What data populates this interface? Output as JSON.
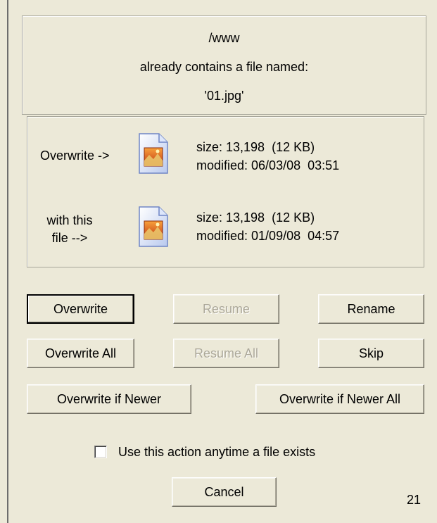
{
  "message": {
    "path": "/www",
    "text": "already contains a file named:",
    "filename": "'01.jpg'"
  },
  "compare": {
    "existing_label": "Overwrite ->",
    "existing_size": "size: 13,198  (12 KB)",
    "existing_modified": "modified: 06/03/08  03:51",
    "new_label_line1": "with this",
    "new_label_line2": "file -->",
    "new_size": "size: 13,198  (12 KB)",
    "new_modified": "modified: 01/09/08  04:57",
    "icon": "image-file-icon"
  },
  "buttons": {
    "overwrite": "Overwrite",
    "resume": "Resume",
    "rename": "Rename",
    "overwrite_all": "Overwrite All",
    "resume_all": "Resume All",
    "skip": "Skip",
    "overwrite_if_newer": "Overwrite if Newer",
    "overwrite_if_newer_all": "Overwrite if Newer All",
    "cancel": "Cancel"
  },
  "checkbox": {
    "label": "Use this action anytime a file exists",
    "checked": false
  },
  "counter": "21",
  "colors": {
    "background": "#ECE9D8",
    "disabled_text": "#ACA899"
  }
}
